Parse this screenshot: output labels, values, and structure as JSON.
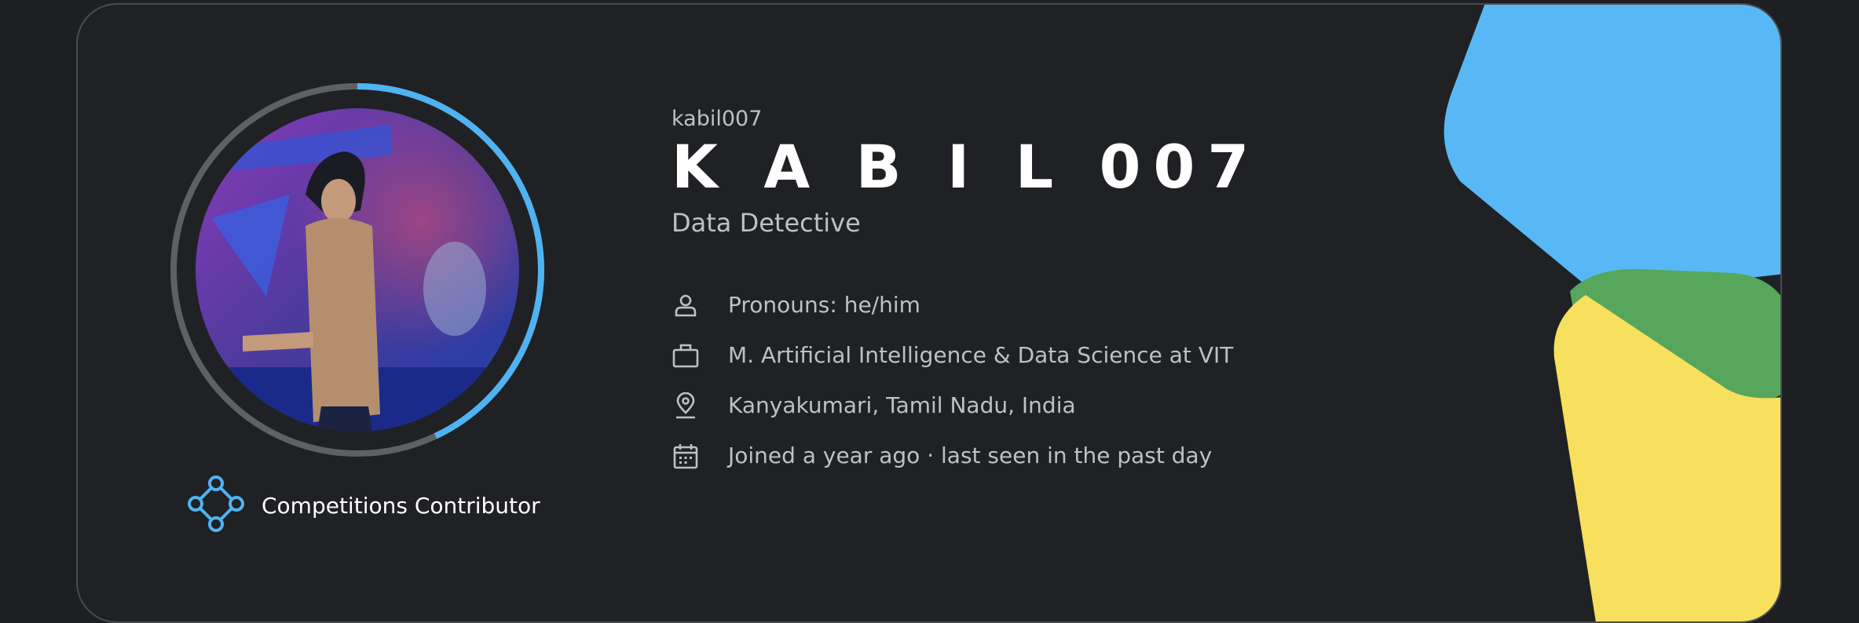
{
  "profile": {
    "handle": "kabil007",
    "display_name": "K A B I L 007",
    "title": "Data Detective",
    "avatar_icon": "profile-photo",
    "progress_fraction": 0.43,
    "badge": {
      "label": "Competitions Contributor",
      "icon": "competitions-icon"
    },
    "details": [
      {
        "icon": "person-icon",
        "text": "Pronouns: he/him"
      },
      {
        "icon": "briefcase-icon",
        "text": "M. Artificial Intelligence & Data Science at VIT"
      },
      {
        "icon": "location-pin-icon",
        "text": "Kanyakumari, Tamil Nadu, India"
      },
      {
        "icon": "calendar-icon",
        "text": "Joined a year ago · last seen in the past day"
      }
    ]
  },
  "colors": {
    "accent_blue": "#4fb3f2",
    "ring_gray": "#5f6063",
    "decor_blue": "#58b8f5",
    "decor_green": "#56a65c",
    "decor_yellow": "#f6e05e",
    "text_primary": "#ffffff",
    "text_secondary": "#bdc1c6"
  }
}
